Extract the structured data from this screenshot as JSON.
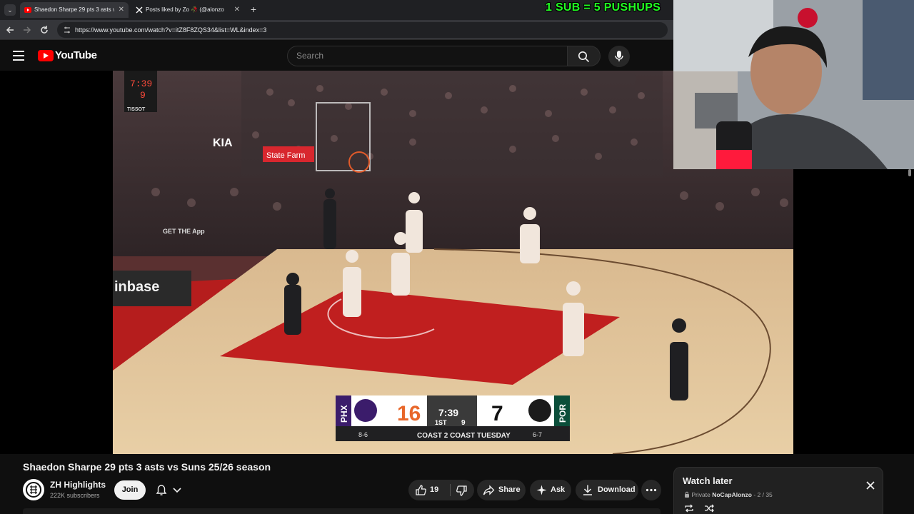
{
  "browser": {
    "tabs": [
      {
        "label": "Shaedon Sharpe 29 pts 3 asts vs",
        "active": true,
        "icon": "youtube-icon"
      },
      {
        "label": "Posts liked by Zo 🥀 (@alonzo",
        "active": false,
        "icon": "x-icon"
      }
    ],
    "close_glyph": "✕",
    "new_tab_glyph": "+",
    "url": "https://www.youtube.com/watch?v=itZ8F8ZQS34&list=WL&index=3"
  },
  "overlay": {
    "banner": "1 SUB = 5 PUSHUPS",
    "banner_color": "#22ff22"
  },
  "youtube": {
    "logo_text": "YouTube",
    "search_placeholder": "Search",
    "brand_color": "#ff0000"
  },
  "scoreboard": {
    "away_abbr": "PHX",
    "away_score": "16",
    "away_record": "8-6",
    "home_abbr": "POR",
    "home_score": "7",
    "home_record": "6-7",
    "clock": "7:39",
    "period": "1ST",
    "shot_clock": "9",
    "show_name": "COAST 2 COAST TUESDAY"
  },
  "arena": {
    "game_clock": "7:39",
    "shot_clock": "9",
    "sponsor_tissot": "TISSOT",
    "sponsor_kia": "KIA",
    "sponsor_statefarm": "State Farm",
    "sponsor_coinbase": "inbase",
    "sponsor_getapp": "GET THE App"
  },
  "video": {
    "title": "Shaedon Sharpe 29 pts 3 asts vs Suns 25/26 season",
    "channel_name": "ZH Highlights",
    "subscribers": "222K subscribers",
    "join_label": "Join",
    "like_count": "19",
    "share_label": "Share",
    "ask_label": "Ask",
    "download_label": "Download"
  },
  "watch_later": {
    "title": "Watch later",
    "privacy": "Private",
    "owner": "NoCapAlonzo",
    "position": "- 2 / 35"
  }
}
